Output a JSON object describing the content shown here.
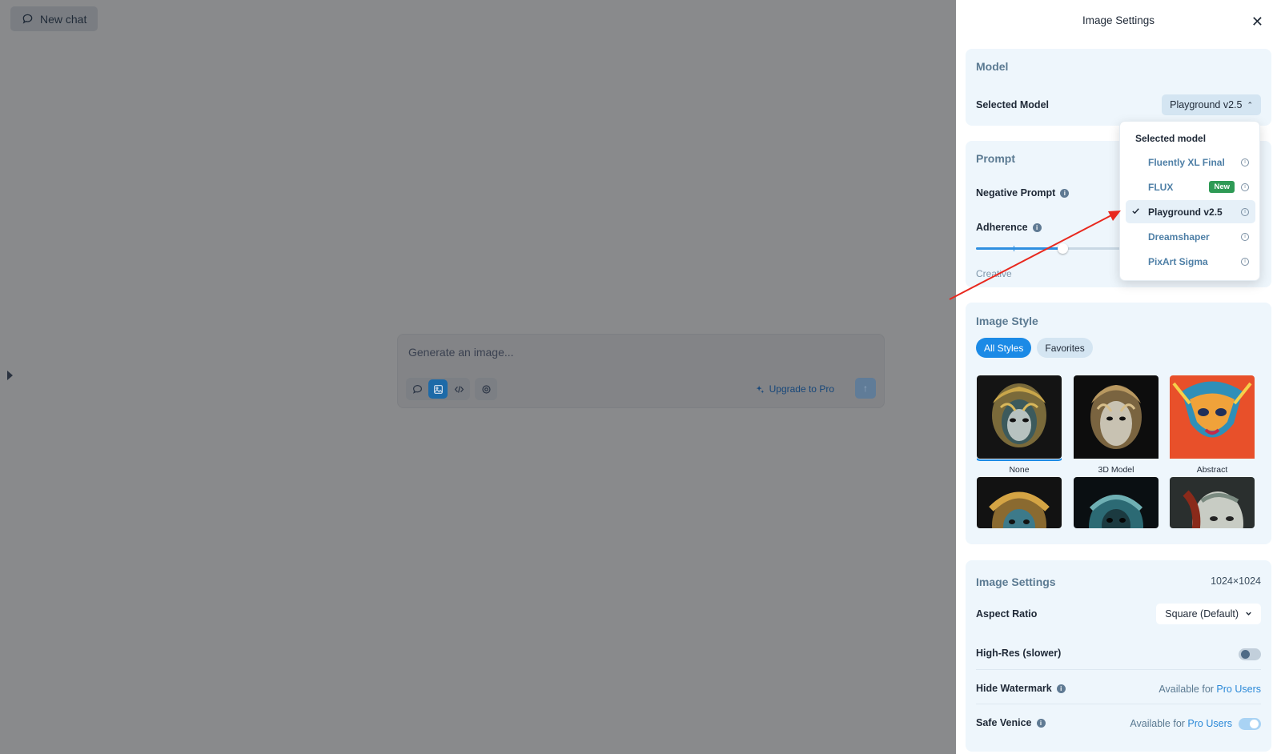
{
  "header": {
    "new_chat_label": "New chat"
  },
  "composer": {
    "placeholder": "Generate an image...",
    "upgrade_label": "Upgrade to Pro"
  },
  "panel": {
    "title": "Image Settings",
    "model": {
      "title": "Model",
      "selected_label": "Selected Model",
      "selected_value": "Playground v2.5"
    },
    "prompt": {
      "title": "Prompt",
      "negative_label": "Negative Prompt",
      "adherence_label": "Adherence",
      "adherence_value": 0.6,
      "creative_label": "Creative"
    },
    "style": {
      "title": "Image Style",
      "tabs": [
        "All Styles",
        "Favorites"
      ],
      "thumbs": [
        {
          "label": "None",
          "selected": true
        },
        {
          "label": "3D Model",
          "selected": false
        },
        {
          "label": "Abstract",
          "selected": false
        },
        {
          "label": "",
          "selected": false
        },
        {
          "label": "",
          "selected": false
        },
        {
          "label": "",
          "selected": false
        }
      ]
    },
    "settings": {
      "title": "Image Settings",
      "resolution": "1024×1024",
      "aspect_label": "Aspect Ratio",
      "aspect_value": "Square (Default)",
      "highres_label": "High-Res (slower)",
      "highres_on": false,
      "watermark_label": "Hide Watermark",
      "watermark_avail": "Available for",
      "pro_users": "Pro Users",
      "safe_label": "Safe Venice",
      "safe_avail": "Available for",
      "safe_on": true
    }
  },
  "dropdown": {
    "header": "Selected model",
    "items": [
      {
        "label": "Fluently XL Final",
        "badge": "",
        "active": false
      },
      {
        "label": "FLUX",
        "badge": "New",
        "active": false
      },
      {
        "label": "Playground v2.5",
        "badge": "",
        "active": true
      },
      {
        "label": "Dreamshaper",
        "badge": "",
        "active": false
      },
      {
        "label": "PixArt Sigma",
        "badge": "",
        "active": false
      }
    ]
  },
  "colors": {
    "accent": "#1b8ae6",
    "badge_green": "#2e9a55",
    "annotation_arrow": "#e8281e"
  }
}
